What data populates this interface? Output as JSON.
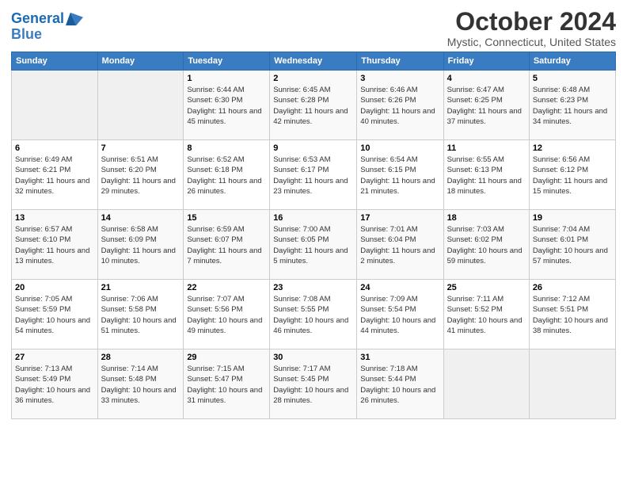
{
  "header": {
    "logo_line1": "General",
    "logo_line2": "Blue",
    "month": "October 2024",
    "location": "Mystic, Connecticut, United States"
  },
  "weekdays": [
    "Sunday",
    "Monday",
    "Tuesday",
    "Wednesday",
    "Thursday",
    "Friday",
    "Saturday"
  ],
  "weeks": [
    [
      {
        "day": "",
        "sunrise": "",
        "sunset": "",
        "daylight": ""
      },
      {
        "day": "",
        "sunrise": "",
        "sunset": "",
        "daylight": ""
      },
      {
        "day": "1",
        "sunrise": "Sunrise: 6:44 AM",
        "sunset": "Sunset: 6:30 PM",
        "daylight": "Daylight: 11 hours and 45 minutes."
      },
      {
        "day": "2",
        "sunrise": "Sunrise: 6:45 AM",
        "sunset": "Sunset: 6:28 PM",
        "daylight": "Daylight: 11 hours and 42 minutes."
      },
      {
        "day": "3",
        "sunrise": "Sunrise: 6:46 AM",
        "sunset": "Sunset: 6:26 PM",
        "daylight": "Daylight: 11 hours and 40 minutes."
      },
      {
        "day": "4",
        "sunrise": "Sunrise: 6:47 AM",
        "sunset": "Sunset: 6:25 PM",
        "daylight": "Daylight: 11 hours and 37 minutes."
      },
      {
        "day": "5",
        "sunrise": "Sunrise: 6:48 AM",
        "sunset": "Sunset: 6:23 PM",
        "daylight": "Daylight: 11 hours and 34 minutes."
      }
    ],
    [
      {
        "day": "6",
        "sunrise": "Sunrise: 6:49 AM",
        "sunset": "Sunset: 6:21 PM",
        "daylight": "Daylight: 11 hours and 32 minutes."
      },
      {
        "day": "7",
        "sunrise": "Sunrise: 6:51 AM",
        "sunset": "Sunset: 6:20 PM",
        "daylight": "Daylight: 11 hours and 29 minutes."
      },
      {
        "day": "8",
        "sunrise": "Sunrise: 6:52 AM",
        "sunset": "Sunset: 6:18 PM",
        "daylight": "Daylight: 11 hours and 26 minutes."
      },
      {
        "day": "9",
        "sunrise": "Sunrise: 6:53 AM",
        "sunset": "Sunset: 6:17 PM",
        "daylight": "Daylight: 11 hours and 23 minutes."
      },
      {
        "day": "10",
        "sunrise": "Sunrise: 6:54 AM",
        "sunset": "Sunset: 6:15 PM",
        "daylight": "Daylight: 11 hours and 21 minutes."
      },
      {
        "day": "11",
        "sunrise": "Sunrise: 6:55 AM",
        "sunset": "Sunset: 6:13 PM",
        "daylight": "Daylight: 11 hours and 18 minutes."
      },
      {
        "day": "12",
        "sunrise": "Sunrise: 6:56 AM",
        "sunset": "Sunset: 6:12 PM",
        "daylight": "Daylight: 11 hours and 15 minutes."
      }
    ],
    [
      {
        "day": "13",
        "sunrise": "Sunrise: 6:57 AM",
        "sunset": "Sunset: 6:10 PM",
        "daylight": "Daylight: 11 hours and 13 minutes."
      },
      {
        "day": "14",
        "sunrise": "Sunrise: 6:58 AM",
        "sunset": "Sunset: 6:09 PM",
        "daylight": "Daylight: 11 hours and 10 minutes."
      },
      {
        "day": "15",
        "sunrise": "Sunrise: 6:59 AM",
        "sunset": "Sunset: 6:07 PM",
        "daylight": "Daylight: 11 hours and 7 minutes."
      },
      {
        "day": "16",
        "sunrise": "Sunrise: 7:00 AM",
        "sunset": "Sunset: 6:05 PM",
        "daylight": "Daylight: 11 hours and 5 minutes."
      },
      {
        "day": "17",
        "sunrise": "Sunrise: 7:01 AM",
        "sunset": "Sunset: 6:04 PM",
        "daylight": "Daylight: 11 hours and 2 minutes."
      },
      {
        "day": "18",
        "sunrise": "Sunrise: 7:03 AM",
        "sunset": "Sunset: 6:02 PM",
        "daylight": "Daylight: 10 hours and 59 minutes."
      },
      {
        "day": "19",
        "sunrise": "Sunrise: 7:04 AM",
        "sunset": "Sunset: 6:01 PM",
        "daylight": "Daylight: 10 hours and 57 minutes."
      }
    ],
    [
      {
        "day": "20",
        "sunrise": "Sunrise: 7:05 AM",
        "sunset": "Sunset: 5:59 PM",
        "daylight": "Daylight: 10 hours and 54 minutes."
      },
      {
        "day": "21",
        "sunrise": "Sunrise: 7:06 AM",
        "sunset": "Sunset: 5:58 PM",
        "daylight": "Daylight: 10 hours and 51 minutes."
      },
      {
        "day": "22",
        "sunrise": "Sunrise: 7:07 AM",
        "sunset": "Sunset: 5:56 PM",
        "daylight": "Daylight: 10 hours and 49 minutes."
      },
      {
        "day": "23",
        "sunrise": "Sunrise: 7:08 AM",
        "sunset": "Sunset: 5:55 PM",
        "daylight": "Daylight: 10 hours and 46 minutes."
      },
      {
        "day": "24",
        "sunrise": "Sunrise: 7:09 AM",
        "sunset": "Sunset: 5:54 PM",
        "daylight": "Daylight: 10 hours and 44 minutes."
      },
      {
        "day": "25",
        "sunrise": "Sunrise: 7:11 AM",
        "sunset": "Sunset: 5:52 PM",
        "daylight": "Daylight: 10 hours and 41 minutes."
      },
      {
        "day": "26",
        "sunrise": "Sunrise: 7:12 AM",
        "sunset": "Sunset: 5:51 PM",
        "daylight": "Daylight: 10 hours and 38 minutes."
      }
    ],
    [
      {
        "day": "27",
        "sunrise": "Sunrise: 7:13 AM",
        "sunset": "Sunset: 5:49 PM",
        "daylight": "Daylight: 10 hours and 36 minutes."
      },
      {
        "day": "28",
        "sunrise": "Sunrise: 7:14 AM",
        "sunset": "Sunset: 5:48 PM",
        "daylight": "Daylight: 10 hours and 33 minutes."
      },
      {
        "day": "29",
        "sunrise": "Sunrise: 7:15 AM",
        "sunset": "Sunset: 5:47 PM",
        "daylight": "Daylight: 10 hours and 31 minutes."
      },
      {
        "day": "30",
        "sunrise": "Sunrise: 7:17 AM",
        "sunset": "Sunset: 5:45 PM",
        "daylight": "Daylight: 10 hours and 28 minutes."
      },
      {
        "day": "31",
        "sunrise": "Sunrise: 7:18 AM",
        "sunset": "Sunset: 5:44 PM",
        "daylight": "Daylight: 10 hours and 26 minutes."
      },
      {
        "day": "",
        "sunrise": "",
        "sunset": "",
        "daylight": ""
      },
      {
        "day": "",
        "sunrise": "",
        "sunset": "",
        "daylight": ""
      }
    ]
  ]
}
